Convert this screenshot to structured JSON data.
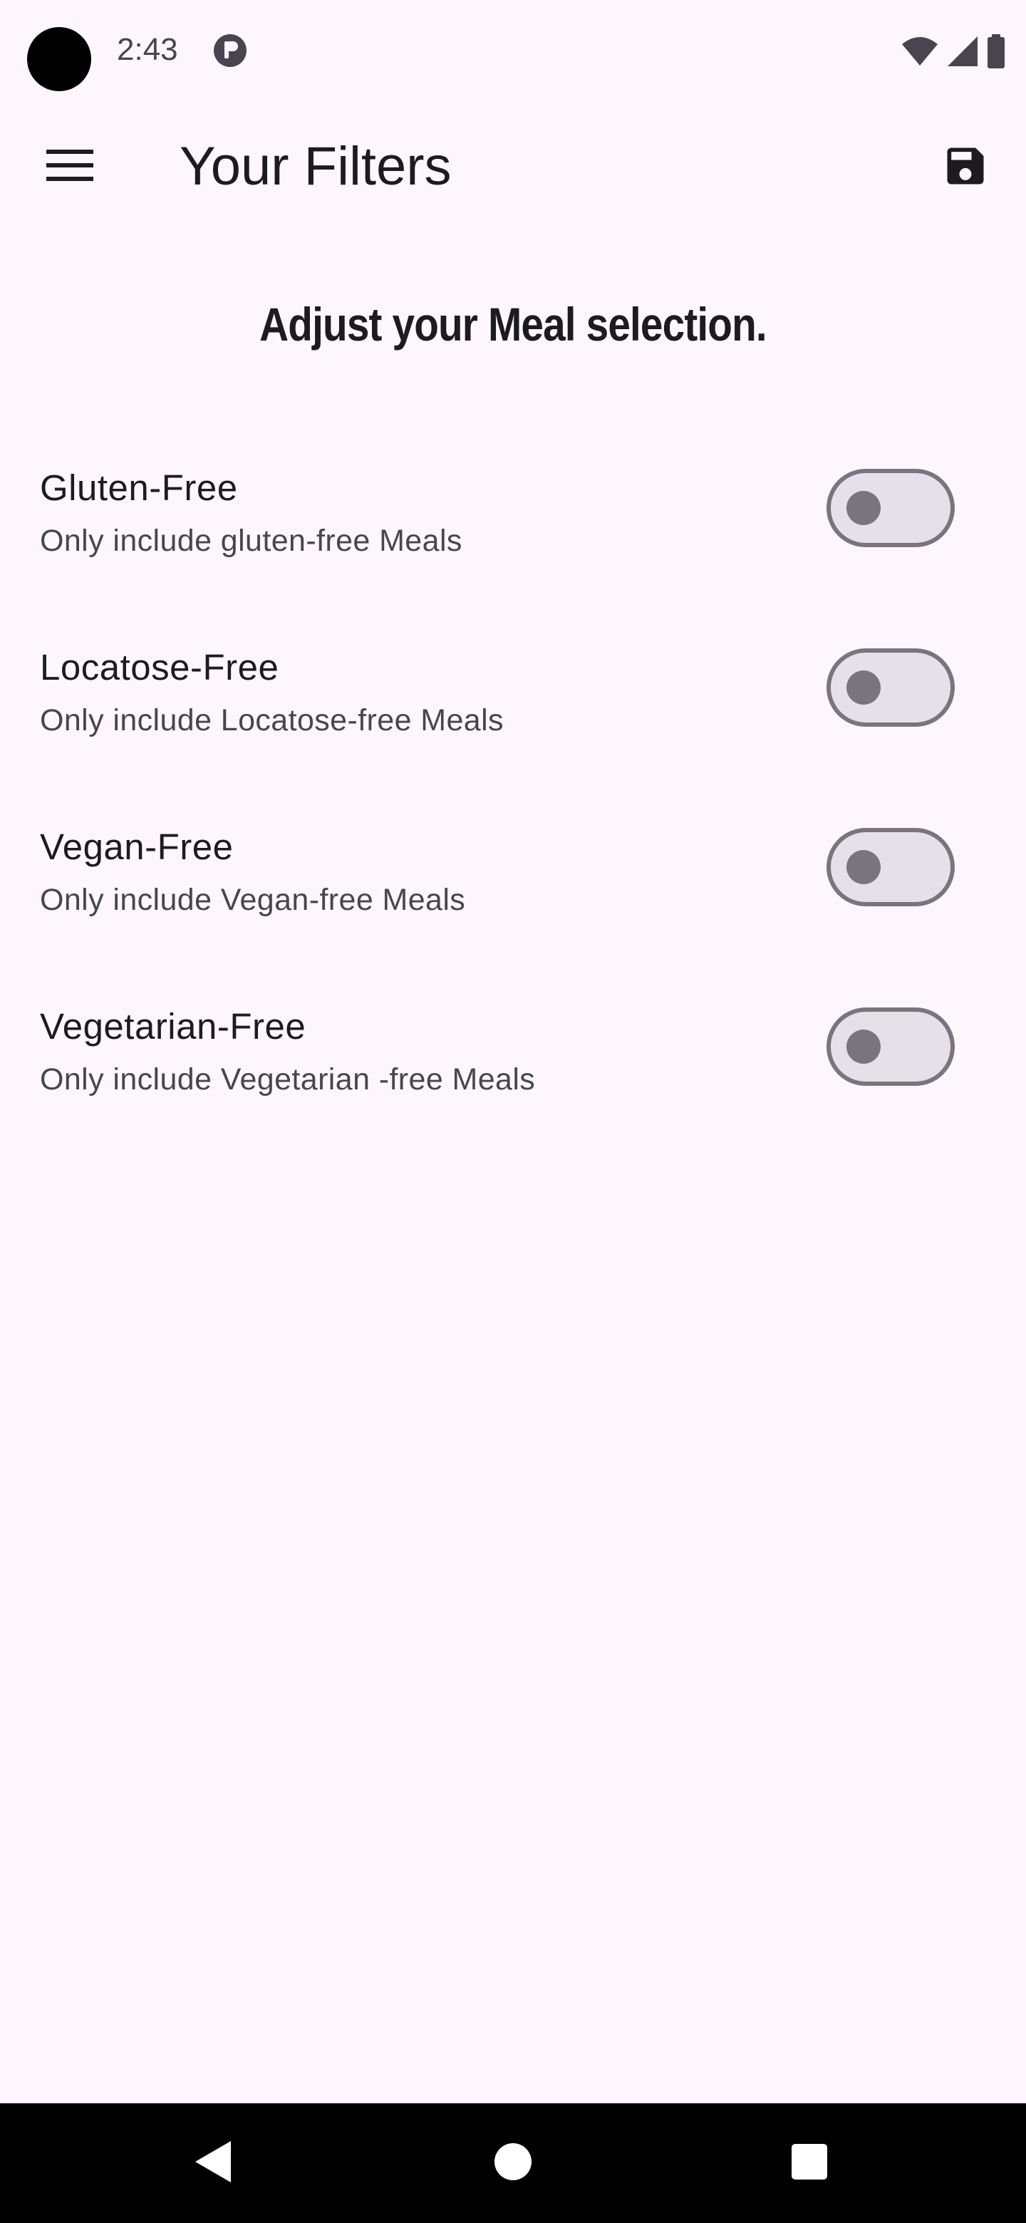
{
  "status_bar": {
    "time": "2:43",
    "icons": [
      "camera-dot",
      "app-notification-icon",
      "wifi-icon",
      "signal-icon",
      "battery-icon"
    ]
  },
  "app_bar": {
    "title": "Your Filters",
    "menu_icon": "hamburger-menu-icon",
    "action_icon": "save-icon"
  },
  "heading": "Adjust your Meal selection.",
  "filters": [
    {
      "title": "Gluten-Free",
      "subtitle": "Only include gluten-free Meals",
      "enabled": false
    },
    {
      "title": "Locatose-Free",
      "subtitle": "Only include Locatose-free Meals",
      "enabled": false
    },
    {
      "title": "Vegan-Free",
      "subtitle": "Only include Vegan-free Meals",
      "enabled": false
    },
    {
      "title": "Vegetarian-Free",
      "subtitle": "Only include Vegetarian -free Meals",
      "enabled": false
    }
  ],
  "nav_bar": {
    "icons": [
      "back-icon",
      "home-icon",
      "recents-icon"
    ]
  },
  "colors": {
    "background": "#fdf7fd",
    "text_primary": "#1d1b20",
    "text_secondary": "#49454f",
    "switch_track": "#e6e0e9",
    "switch_outline": "#79747e",
    "nav_bar": "#000000"
  }
}
